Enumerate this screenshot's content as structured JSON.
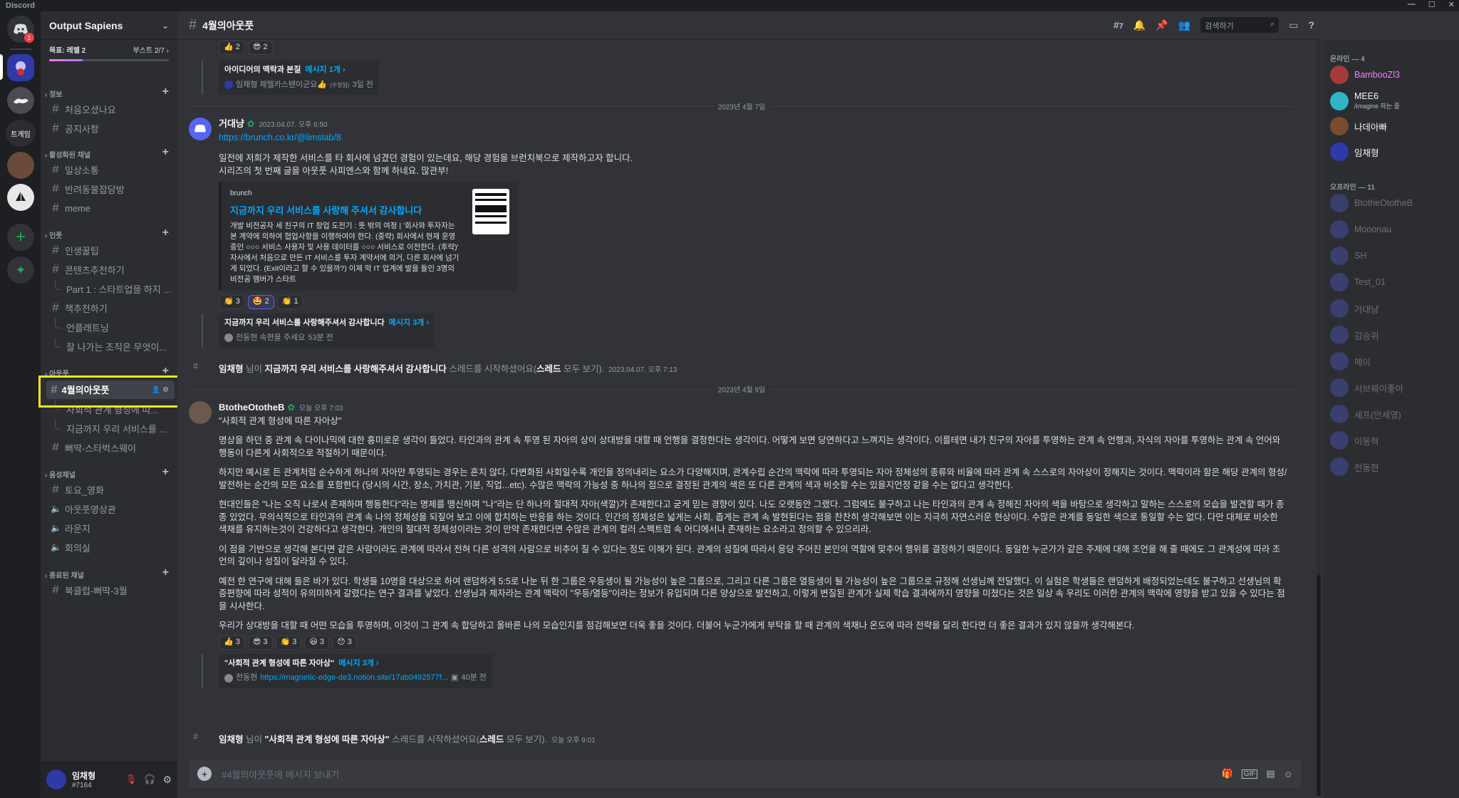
{
  "window": {
    "app_title": "Discord"
  },
  "guild": {
    "name": "Output Sapiens",
    "goal_label": "목표: 레벨 2",
    "boost_label": "부스트 2/7 ›",
    "boost_progress": 0.28
  },
  "categories": {
    "info": "정보",
    "active": "활성화된 채널",
    "insight": "인풋",
    "output": "아웃풋",
    "voice": "음성채널",
    "ended": "종료된 채널"
  },
  "channels": {
    "welcome": "처음오셨나요",
    "notice": "공지사항",
    "daily": "일상소통",
    "pets": "반려동물잡담방",
    "meme": "meme",
    "tips": "인생꿀팁",
    "content": "콘텐츠추천하기",
    "part1": "Part 1 : 스타트업을 하지 ...",
    "books": "책추천하기",
    "lecture": "언플래트닝",
    "org": "잘 나가는 조직은 무엇이...",
    "april": "4월의아웃풋",
    "april_sub1": "사회적 관계 형성에 따...",
    "april_sub2": "지금까지 우리 서비스를 ...",
    "starbucks": "뻐딱-스타벅스웨이",
    "v_sat": "토요_영화",
    "v_output": "아웃풋영상관",
    "v_lounge": "라운지",
    "v_meeting": "회의실",
    "ended_club": "북클럽-뻐딱-3월"
  },
  "user": {
    "name": "임채형",
    "tag": "#7164"
  },
  "topbar": {
    "channel": "4월의아웃풋",
    "thread_count": "7",
    "search_placeholder": "검색하기"
  },
  "top_thread": {
    "reactions": [
      "👍 2",
      "😎 2"
    ],
    "title": "아이디어의 맥락과 본질",
    "count": "메시지 1개 ›",
    "preview": "임채형 제텔카스텐이군요👍",
    "edited": "(수정됨)",
    "time": "3일 전"
  },
  "divider1": "2023년 4월 7일",
  "msg1": {
    "author": "거대냥",
    "time": "2023.04.07. 오후 6:50",
    "link": "https://brunch.co.kr/@limslab/8",
    "text": "일전에 저희가 제작한 서비스를 타 회사에 넘겼던 경험이 있는데요, 해당 경험을 브런치북으로 제작하고자 합니다.\n시리즈의 첫 번째 글을 아웃풋 사피엔스와 함께 하네요. 많관부!",
    "embed_provider": "brunch",
    "embed_title": "지금까지 우리 서비스를 사랑해 주셔서 감사합니다",
    "embed_desc": "개발 비전공자 세 친구의 IT 창업 도전기 : 뜻 밖의 여정 | '회사와 투자자는 본 계약에 의하여 협업사항을 이행하여야 한다. (중략) 회사에서 현재 운영중인 ○○○ 서비스 사용자 및 사용 데이터를 ○○○ 서비스로 이전한다. (후략)' 자사에서 처음으로 만든 IT 서비스를 투자 계약서에 의거, 다른 회사에 넘기게 되었다. (Exit이라고 할 수 있을까?) 이제 막 IT 업계에 발을 들인 3명의 비전공 멤버가 스타트",
    "reactions": [
      "👏 3",
      "🤩 2",
      "👏 1"
    ],
    "thread_title": "지금까지 우리 서비스를 사랑해주셔서 감사합니다",
    "thread_count": "메시지 3개 ›",
    "thread_preview": "전동현 속편을 주세요",
    "thread_time": "53분 전"
  },
  "sys1": {
    "who": "임채형",
    "mid": " 님이 ",
    "thread": "지금까지 우리 서비스를 사랑해주셔서 감사합니다",
    "tail": " 스레드를 시작하셨어요(",
    "see": "스레드",
    "all": " 모두 보기).",
    "time": "2023.04.07. 오후 7:13"
  },
  "divider2": "2023년 4월 9일",
  "msg2": {
    "author": "BtotheOtotheB",
    "time": "오늘 오후 7:03",
    "title": "\"사회적 관계 형성에 따른 자아상\"",
    "p1": "명상을 하던 중 관계 속 다이나믹에 대한 흥미로운 생각이 들었다. 타인과의 관계 속 투영 된 자아의 상이 상대방을 대할 때 언행을 결정한다는 생각이다. 어떻게 보면 당연하다고 느껴지는 생각이다. 이를테면 내가 친구의 자아를 투영하는 관계 속 언행과, 자식의 자아를 투영하는 관계 속 언어와 행동이 다른게 사회적으로 적절하기 때문이다.",
    "p2": "하지만 예시로 든 관계처럼 순수하게 하나의 자아만 투영되는 경우는 흔치 않다. 다변화된 사회일수록 개인을 정의내리는 요소가 다양해지며, 관계수립 순간의 맥락에 따라 투영되는 자아 정체성의 종류와 비율에 따라 관계 속 스스로의 자아상이 정해지는 것이다. 맥락이라 함은 해당 관계의 형성/발전하는 순간의 모든 요소를 포함한다 (당시의 시간, 장소, 가치관, 기분, 직업...etc). 수많은 맥락의 가능성 중 하나의 점으로 결정된 관계의 색은 또 다른 관계의 색과 비슷할 수는 있을지언정 같을 수는 없다고 생각한다.",
    "p3": "현대인들은 \"나는 오직 나로서 존재하며 행동한다\"라는 명제를 맹신하며 \"나\"라는 단 하나의 절대적 자아(색깔)가 존재한다고 굳게 믿는 경향이 있다. 나도 오랫동안 그랬다. 그럼에도 불구하고 나는 타인과의 관계 속 정해진 자아의 색을 바탕으로 생각하고 말하는 스스로의 모습을 발견할 때가 종종 있었다. 무의식적으로 타인과의 관계 속 나의 정체성을 되짚어 보고 이에 합치하는 반응을 하는 것이다. 인간의 정체성은 넓게는 사회, 좁게는 관계 속 발현된다는 점을 찬찬히 생각해보면 이는 지극히 자연스러운 현상이다. 수많은 관계를 동일한 색으로 통일할 수는 없다. 다만 대체로 비슷한 색채를 유지하는것이 건강하다고 생각한다. 개인의 절대적 정체성이라는 것이 만약 존재한다면 수많은 관계의 컬러 스펙트럼 속 어디에서나 존재하는 요소라고 정의할 수 있으리라.",
    "p4": "이 점을 기반으로 생각해 본다면 같은 사람이라도 관계에 따라서 전혀 다른 성격의 사람으로 비추어 질 수 있다는 정도 이해가 된다. 관계의 성질에 따라서 응당 주어진 본인의 역할에 맞추어 행위를 결정하기 때문이다. 동일한 누군가가 같은 주제에 대해 조언을 해 줄 때에도 그 관계성에 따라 조언의 깊이나 성질이 달라질 수 있다.",
    "p5": "예전 한 연구에 대해 들은 바가 있다. 학생들 10명을 대상으로 하여 랜덤하게 5:5로 나눈 뒤 한 그룹은 우등생이 될 가능성이 높은 그룹으로, 그리고 다른 그룹은 열등생이 될 가능성이 높은 그룹으로 규정해 선생님께 전달했다. 이 실험은 학생들은 랜덤하게 배정되었는데도 불구하고 선생님의 확증편향에 따라 성적이 유의미하게 갈렸다는 연구 결과를 낳았다. 선생님과 제자라는 관계 맥락이 \"우등/열등\"이라는 정보가 유입되며 다른 양상으로 발전하고, 이렇게 변질된 관계가 실제 학습 결과에까지 영향을 미쳤다는 것은 일상 속 우리도 이러한 관계의 맥락에 영향을 받고 있을 수 있다는 점을 시사한다.",
    "p6": "우리가 상대방을 대할 때 어떤 모습을 투영하며, 이것이 그 관계 속 합당하고 올바른 나의 모습인지를 점검해보면 더욱 좋을 것이다. 더불어 누군가에게 부탁을 할 때 관계의 색채나 온도에 따라 전략을 달리 한다면 더 좋은 결과가 있지 않을까 생각해본다.",
    "reactions": [
      "👍 3",
      "😎 3",
      "👏 3",
      "😃 3",
      "😯 3"
    ],
    "thread_title": "\"사회적 관계 형성에 따른 자아상\"",
    "thread_count": "메시지 3개 ›",
    "thread_preview_name": "전동현",
    "thread_preview_link": "https://magnetic-edge-de3.notion.site/17ab0492577f...",
    "thread_time": "40분 전"
  },
  "sys2": {
    "who": "임채형",
    "mid": " 님이 ",
    "thread": "\"사회적 관계 형성에 따른 자아상\"",
    "tail": " 스레드를 시작하셨어요(",
    "see": "스레드",
    "all": " 모두 보기).",
    "time": "오늘 오후 9:01"
  },
  "composer": {
    "placeholder": "#4월의아웃풋에 메시지 보내기"
  },
  "members": {
    "online_header": "온라인 — 4",
    "offline_header": "오프라인 — 11",
    "online": [
      {
        "name": "BambooZl3",
        "color": "#f47fff"
      },
      {
        "name": "MEE6",
        "sub": "/imagine 하는 중",
        "color": "#f2f3f5"
      },
      {
        "name": "나데아빠",
        "color": "#f2f3f5"
      },
      {
        "name": "임채형",
        "color": "#f2f3f5"
      }
    ],
    "offline": [
      "BtotheOtotheB",
      "Mooonau",
      "SH",
      "Test_01",
      "거대냥",
      "김승위",
      "메이",
      "서브웨이좋아",
      "세프(안세영)",
      "이동혁",
      "전동현"
    ]
  },
  "colors": {
    "accent": "#5865f2",
    "link": "#00a8fc",
    "highlight": "#f2e71d"
  }
}
